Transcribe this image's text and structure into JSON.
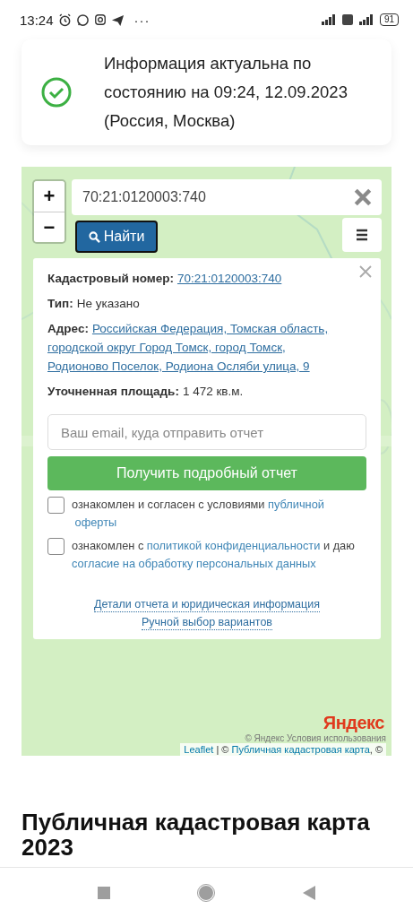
{
  "status_bar": {
    "time": "13:24",
    "more": "···",
    "battery": "91"
  },
  "notice": {
    "text": "Информация актуальна по состоянию на 09:24, 12.09.2023 (Россия, Москва)"
  },
  "map": {
    "zoom_in": "+",
    "zoom_out": "−",
    "search": {
      "value": "70:21:0120003:740"
    },
    "find_button": "Найти",
    "popup": {
      "fields": [
        {
          "label": "Кадастровый номер:",
          "lines": [
            "70:21:0120003:740"
          ],
          "kind": "link"
        },
        {
          "label": "Тип:",
          "lines": [
            "Не указано"
          ],
          "kind": "text"
        },
        {
          "label": "Адрес:",
          "lines": [
            "Российская Федерация, Томская область,",
            "городской округ Город Томск, город Томск,",
            "Родионово Поселок, Родиона Осляби улица, 9"
          ],
          "kind": "link"
        },
        {
          "label": "Уточненная площадь:",
          "lines": [
            "1 472 кв.м."
          ],
          "kind": "text"
        }
      ],
      "email": {
        "placeholder": "Ваш email, куда отправить отчет"
      },
      "report_button": "Получить подробный отчет",
      "consents": [
        {
          "checked": false,
          "parts": [
            {
              "text": "ознакомлен и согласен с условиями ",
              "kind": "text"
            },
            {
              "text": "публичной",
              "kind": "link"
            },
            {
              "text": "оферты",
              "kind": "link"
            }
          ]
        },
        {
          "checked": false,
          "parts": [
            {
              "text": "ознакомлен с ",
              "kind": "text"
            },
            {
              "text": "политикой конфиденциальности",
              "kind": "link"
            },
            {
              "text": " и даю ",
              "kind": "text"
            },
            {
              "text": "согласие на обработку персональных данных",
              "kind": "link"
            }
          ]
        }
      ],
      "links": [
        "Детали отчета и юридическая информация",
        "Ручной выбор вариантов"
      ]
    },
    "logo": "Яндекс",
    "yandex_terms": "© Яндекс  Условия использования",
    "attribution": [
      {
        "text": "Leaflet",
        "kind": "link"
      },
      {
        "text": " | © ",
        "kind": "text"
      },
      {
        "text": "Публичная кадастровая карта",
        "kind": "link"
      },
      {
        "text": ", ©",
        "kind": "text"
      }
    ]
  },
  "heading": "Публичная кадастровая карта 2023"
}
